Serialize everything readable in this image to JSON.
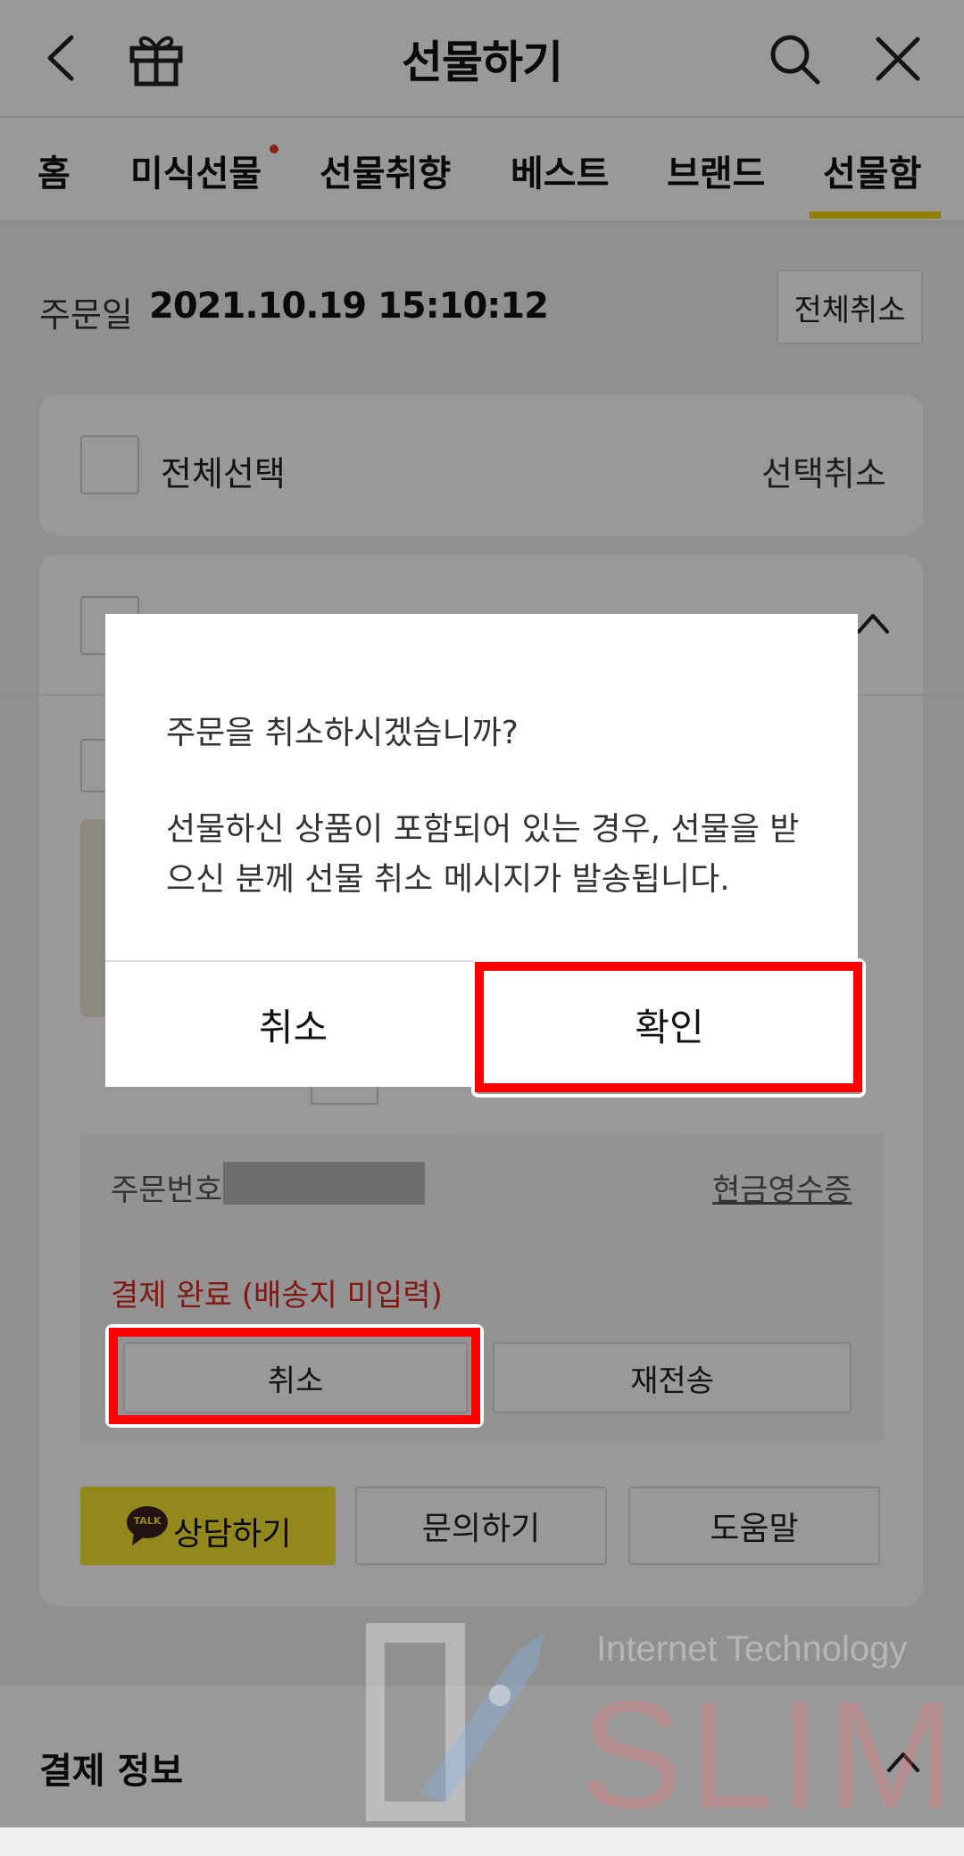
{
  "header": {
    "title": "선물하기"
  },
  "tabs": [
    {
      "label": "홈"
    },
    {
      "label": "미식선물"
    },
    {
      "label": "선물취향"
    },
    {
      "label": "베스트"
    },
    {
      "label": "브랜드"
    },
    {
      "label": "선물함"
    }
  ],
  "order": {
    "date_label": "주문일",
    "date_value": "2021.10.19  15:10:12",
    "cancel_all_button": "전체취소",
    "select_all_label": "전체선택",
    "cancel_selected_button": "선택취소",
    "order_number_label": "주문번호",
    "cash_receipt_link": "현금영수증",
    "status_text": "결제 완료 (배송지 미입력)",
    "cancel_button": "취소",
    "resend_button": "재전송",
    "talk_badge": "TALK",
    "consult_button": "상담하기",
    "inquiry_button": "문의하기",
    "help_button": "도움말"
  },
  "payment_section": {
    "title": "결제 정보"
  },
  "dialog": {
    "message_line1": "주문을 취소하시겠습니까?",
    "message_line2": "선물하신 상품이 포함되어 있는 경우, 선물을 받으신 분께 선물 취소 메시지가 발송됩니다.",
    "cancel_label": "취소",
    "confirm_label": "확인"
  },
  "watermark": {
    "line1": "Internet Technology",
    "line2": "SLIM"
  },
  "colors": {
    "accent_yellow": "#f2d400",
    "highlight_red": "#ff0000",
    "status_red": "#d7281f",
    "new_dot": "#e03a2e"
  }
}
